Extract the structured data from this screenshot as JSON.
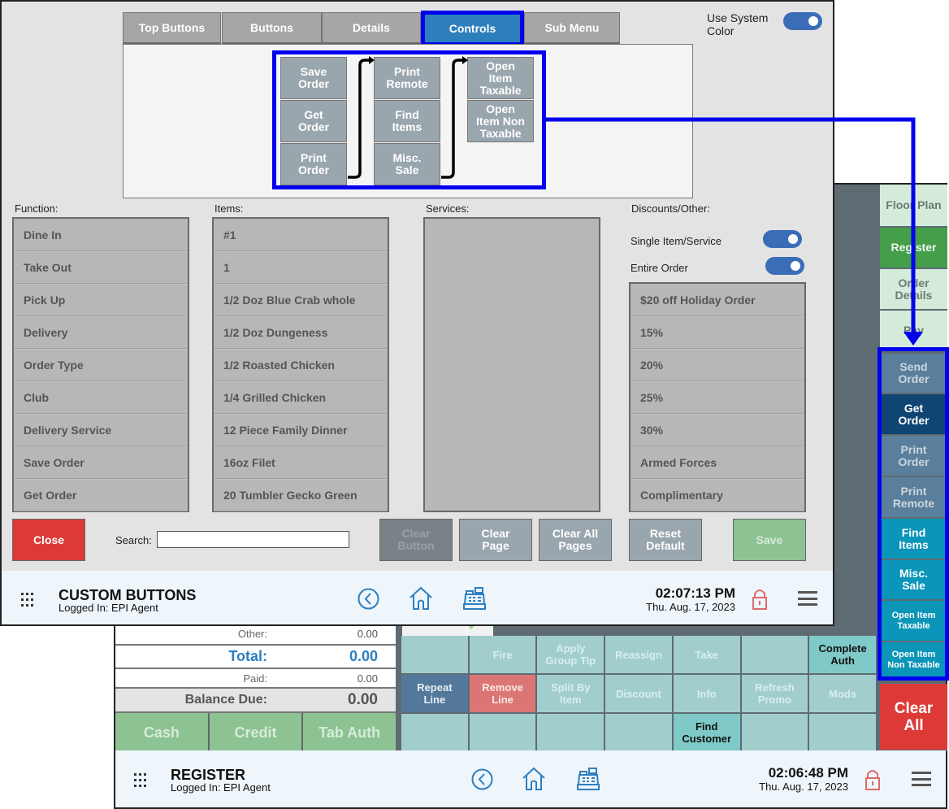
{
  "register_window": {
    "side_nav": [
      {
        "label": "Floor Plan",
        "state": "nav"
      },
      {
        "label": "Register",
        "state": "active"
      },
      {
        "label": "Order Details",
        "state": "nav"
      },
      {
        "label": "Pay",
        "state": "nav"
      }
    ],
    "side_controls": [
      {
        "label": "Send Order"
      },
      {
        "label": "Get Order"
      },
      {
        "label": "Print Order"
      },
      {
        "label": "Print Remote"
      },
      {
        "label": "Find Items"
      },
      {
        "label": "Misc. Sale"
      },
      {
        "label": "Open Item Taxable"
      },
      {
        "label": "Open Item Non Taxable"
      }
    ],
    "clear_all_label": "Clear All",
    "totals": {
      "other_label": "Other:",
      "other_value": "0.00",
      "total_label": "Total:",
      "total_value": "0.00",
      "paid_label": "Paid:",
      "paid_value": "0.00",
      "balance_label": "Balance Due:",
      "balance_value": "0.00"
    },
    "payment_buttons": [
      "Cash",
      "Credit",
      "Tab Auth"
    ],
    "function_grid": [
      "",
      "Fire",
      "Apply Group Tip",
      "Reassign",
      "Take",
      "",
      "Complete Auth",
      "Repeat Line",
      "Remove Line",
      "Split By Item",
      "Discount",
      "Info",
      "Refresh Promo",
      "Mods",
      "",
      "",
      "",
      "",
      "Find Customer",
      "",
      ""
    ],
    "bottom_bar": {
      "title": "REGISTER",
      "logged_in": "Logged In:  EPI Agent",
      "time": "02:06:48 PM",
      "date": "Thu. Aug. 17, 2023"
    }
  },
  "custom_buttons_window": {
    "tabs": [
      {
        "label": "Top Buttons",
        "active": false
      },
      {
        "label": "Buttons",
        "active": false
      },
      {
        "label": "Details",
        "active": false
      },
      {
        "label": "Controls",
        "active": true
      },
      {
        "label": "Sub Menu",
        "active": false
      }
    ],
    "use_system_color": {
      "label": "Use System Color",
      "on": true
    },
    "preview_buttons": {
      "column_1": [
        "Save Order",
        "Get Order",
        "Print Order"
      ],
      "column_2": [
        "Print Remote",
        "Find Items",
        "Misc. Sale"
      ],
      "column_3": [
        "Open Item Taxable",
        "Open Item Non Taxable"
      ]
    },
    "function": {
      "label": "Function:",
      "items": [
        "Dine In",
        "Take Out",
        "Pick Up",
        "Delivery",
        "Order Type",
        "Club",
        "Delivery Service",
        "Save Order",
        "Get Order"
      ]
    },
    "items": {
      "label": "Items:",
      "items": [
        "#1",
        "1",
        "1/2 Doz Blue Crab whole",
        "1/2 Doz Dungeness",
        "1/2 Roasted Chicken",
        "1/4 Grilled Chicken",
        "12 Piece Family Dinner",
        "16oz Filet",
        "20 Tumbler Gecko Green"
      ]
    },
    "services": {
      "label": "Services:",
      "items": []
    },
    "discounts": {
      "label": "Discounts/Other:",
      "single_item_label": "Single Item/Service",
      "single_item_on": true,
      "entire_order_label": "Entire Order",
      "entire_order_on": true,
      "items": [
        "$20 off Holiday Order",
        "15%",
        "20%",
        "25%",
        "30%",
        "Armed Forces",
        "Complimentary"
      ]
    },
    "actions": {
      "close": "Close",
      "search_label": "Search:",
      "search_value": "",
      "clear_button": "Clear Button",
      "clear_page": "Clear Page",
      "clear_all_pages": "Clear All Pages",
      "reset_default": "Reset Default",
      "save": "Save"
    },
    "bottom_bar": {
      "title": "CUSTOM BUTTONS",
      "logged_in": "Logged In:  EPI Agent",
      "time": "02:07:13 PM",
      "date": "Thu. Aug. 17, 2023"
    }
  },
  "colors": {
    "highlight": "#0000ee",
    "active_tab": "#2d7fbb",
    "close": "#dd3a37",
    "save": "#8dc392",
    "toggle_on": "#3b6cb6"
  }
}
